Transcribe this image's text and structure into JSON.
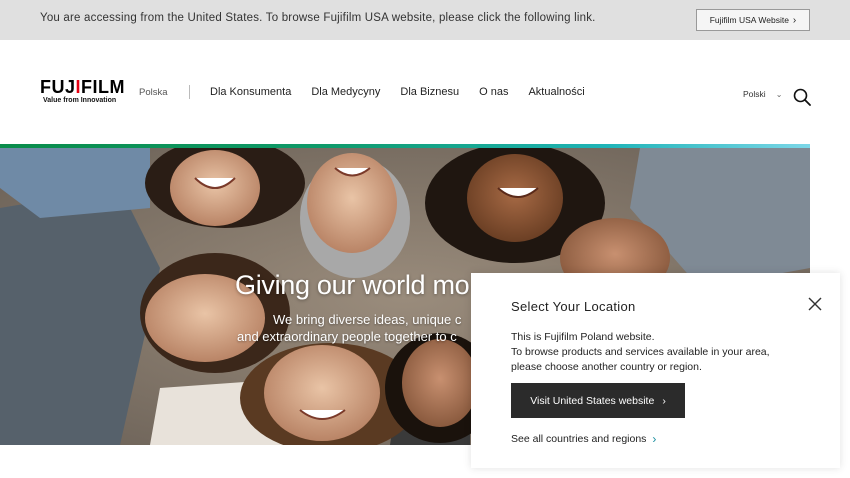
{
  "notice": {
    "text": "You are accessing from the United States. To browse Fujifilm USA website, please click the following link.",
    "button_label": "Fujifilm USA Website",
    "button_icon": "chevron-right-icon"
  },
  "header": {
    "logo_word": "FUJIFILM",
    "logo_tagline": "Value from Innovation",
    "country": "Polska",
    "nav": [
      "Dla Konsumenta",
      "Dla Medycyny",
      "Dla Biznesu",
      "O nas",
      "Aktualności"
    ],
    "language": "Polski",
    "language_icon": "chevron-down-icon",
    "search_icon": "search-icon"
  },
  "hero": {
    "title": "Giving our world mo",
    "subtitle_line1": "We bring diverse ideas, unique c",
    "subtitle_line2": "and extraordinary people together to c"
  },
  "popup": {
    "title": "Select Your Location",
    "body_line1": "This is Fujifilm Poland website.",
    "body_line2": "To browse products and services available in your area,",
    "body_line3": "please choose another country or region.",
    "primary_button": "Visit United States website",
    "link": "See all countries and regions",
    "close_icon": "close-icon"
  },
  "colors": {
    "notice_bg": "#e0e0e0",
    "accent_gradient_start": "#0a8c4a",
    "accent_gradient_end": "#7cd7e8",
    "logo_red": "#e60012",
    "button_dark": "#2b2b2b",
    "link_chevron": "#1a8fa0"
  }
}
